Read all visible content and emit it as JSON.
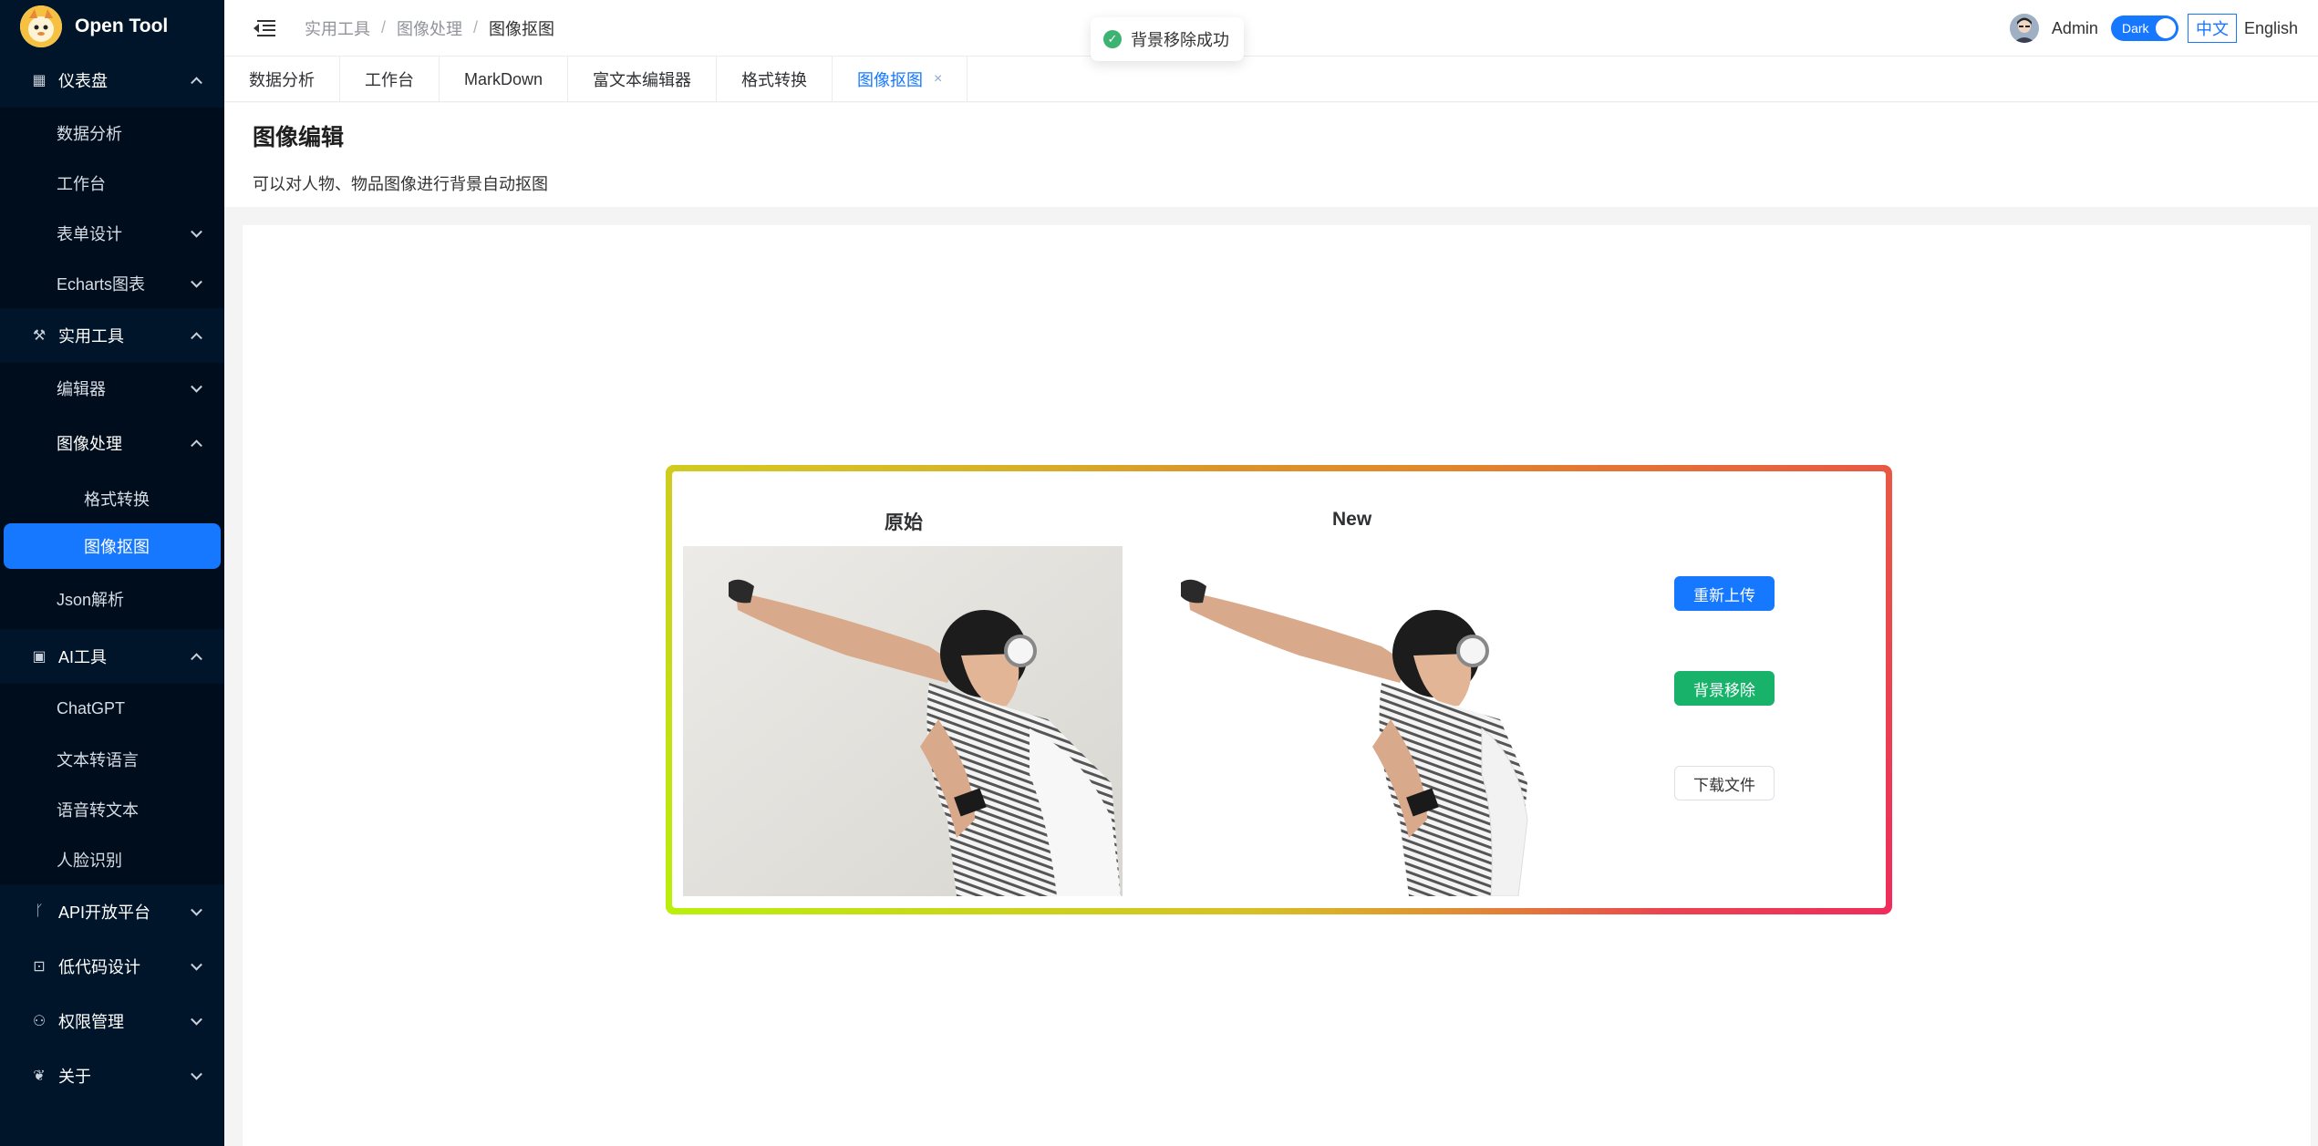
{
  "app": {
    "logo_text": "Open Tool"
  },
  "sidebar": {
    "dashboard": {
      "label": "仪表盘",
      "items": [
        "数据分析",
        "工作台",
        "表单设计",
        "Echarts图表"
      ]
    },
    "tools": {
      "label": "实用工具",
      "editor": "编辑器",
      "image": {
        "label": "图像处理",
        "items": [
          "格式转换",
          "图像抠图"
        ]
      },
      "json": "Json解析"
    },
    "ai": {
      "label": "AI工具",
      "items": [
        "ChatGPT",
        "文本转语言",
        "语音转文本",
        "人脸识别"
      ]
    },
    "api": "API开放平台",
    "lowcode": "低代码设计",
    "auth": "权限管理",
    "about": "关于"
  },
  "header": {
    "breadcrumb": [
      "实用工具",
      "图像处理",
      "图像抠图"
    ],
    "breadcrumb_sep": "/",
    "username": "Admin",
    "theme_toggle": "Dark",
    "lang_zh": "中文",
    "lang_en": "English"
  },
  "tabs": [
    "数据分析",
    "工作台",
    "MarkDown",
    "富文本编辑器",
    "格式转换",
    "图像抠图"
  ],
  "tab_close": "×",
  "page": {
    "title": "图像编辑",
    "description": "可以对人物、物品图像进行背景自动抠图"
  },
  "editor": {
    "original_title": "原始",
    "new_title": "New",
    "reupload": "重新上传",
    "remove_bg": "背景移除",
    "download": "下载文件"
  },
  "toast": {
    "message": "背景移除成功",
    "icon": "check-icon"
  },
  "colors": {
    "sidebar_bg": "#001529",
    "primary": "#1677ff",
    "success": "#18b26b",
    "gradient": [
      "#b9f00a",
      "#e0892a",
      "#f02b5c"
    ]
  }
}
